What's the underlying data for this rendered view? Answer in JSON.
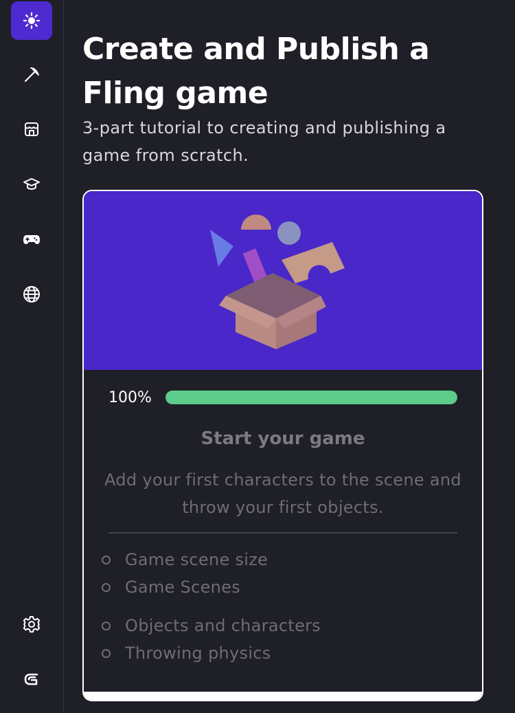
{
  "sidebar": {
    "items": [
      {
        "icon": "sun-icon",
        "active": true
      },
      {
        "icon": "pickaxe-icon",
        "active": false
      },
      {
        "icon": "store-icon",
        "active": false
      },
      {
        "icon": "graduation-cap-icon",
        "active": false
      },
      {
        "icon": "gamepad-icon",
        "active": false
      },
      {
        "icon": "globe-icon",
        "active": false
      }
    ],
    "bottom_items": [
      {
        "icon": "gear-icon"
      },
      {
        "icon": "gdevelop-logo-icon"
      }
    ],
    "accent_color": "#4d2bd1"
  },
  "header": {
    "title": "Create and Publish a Fling game",
    "subtitle": "3-part tutorial to creating and publishing a game from scratch."
  },
  "card": {
    "image_icon": "open-box-illustration",
    "progress": {
      "label": "100%",
      "value": 1.0,
      "color": "#5ccb8b"
    },
    "step_title": "Start your game",
    "step_description": "Add your first characters to the scene and throw your first objects.",
    "lessons": [
      "Game scene size",
      "Game Scenes",
      "Objects and characters",
      "Throwing physics"
    ]
  }
}
